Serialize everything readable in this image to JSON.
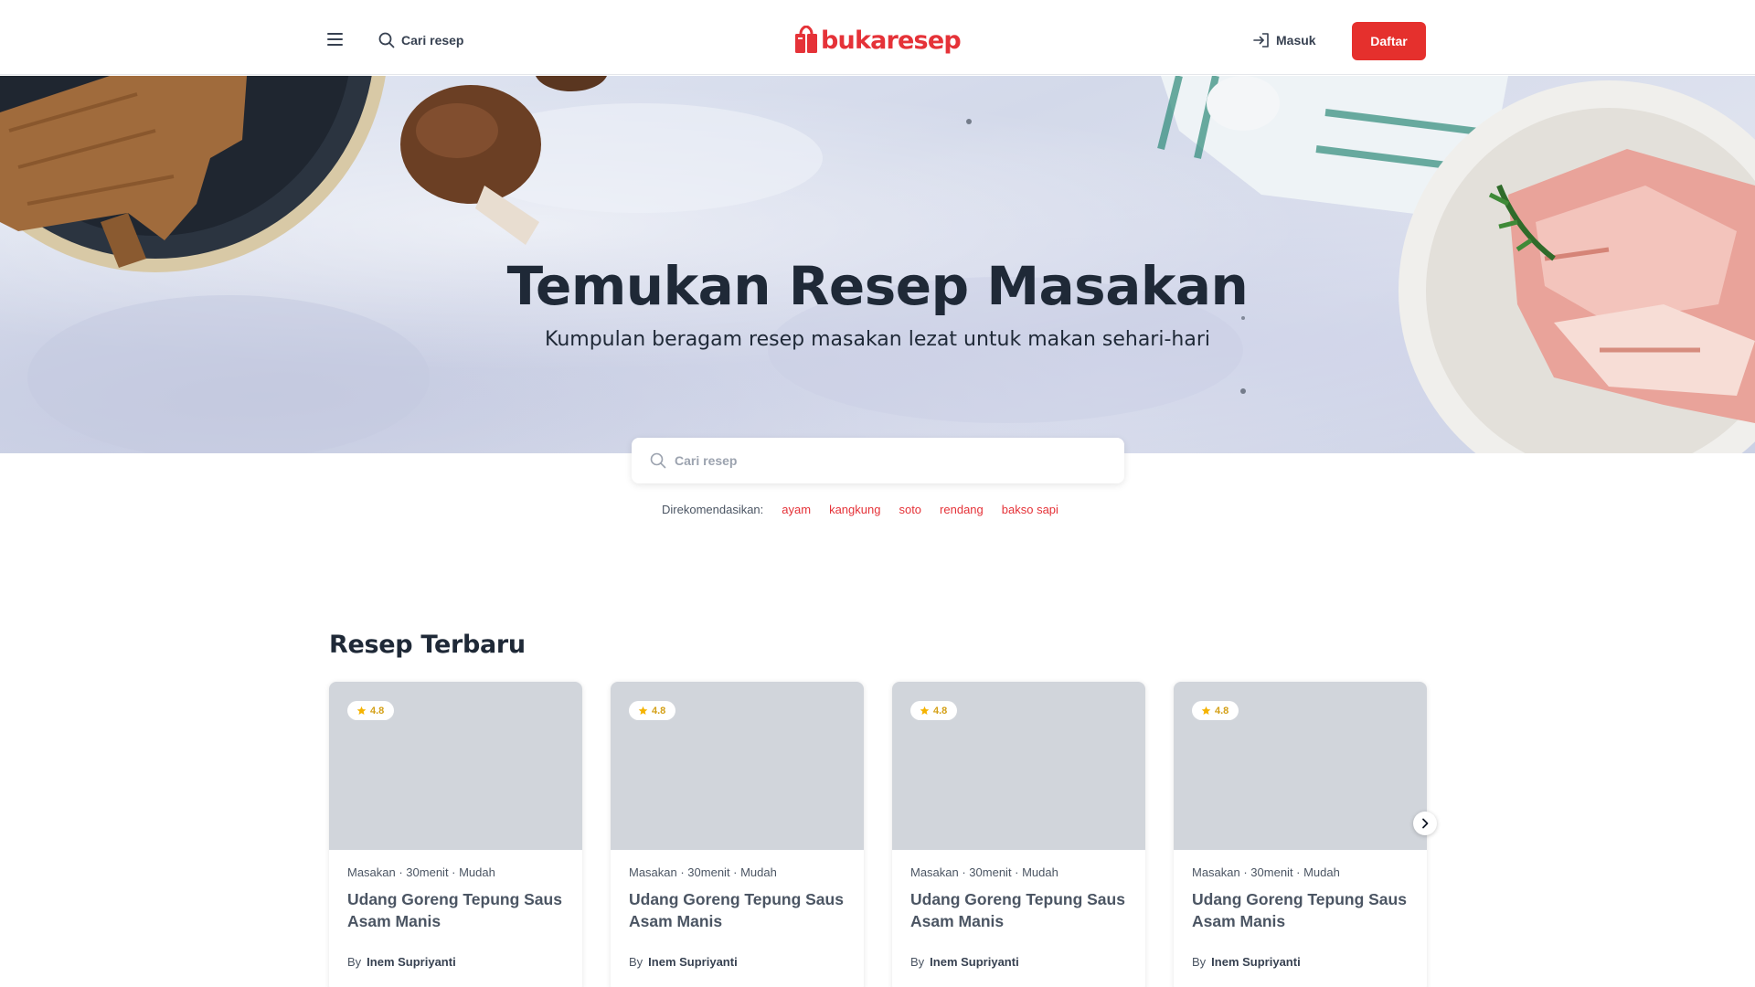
{
  "nav": {
    "search_label": "Cari resep",
    "logo_text": "bukaresep",
    "login_label": "Masuk",
    "register_label": "Daftar"
  },
  "hero": {
    "title": "Temukan Resep Masakan",
    "subtitle": "Kumpulan beragam resep masakan lezat untuk makan sehari-hari"
  },
  "search": {
    "placeholder": "Cari resep",
    "recommend_label": "Direkomendasikan:",
    "tags": [
      "ayam",
      "kangkung",
      "soto",
      "rendang",
      "bakso sapi"
    ]
  },
  "recipes": {
    "section_title": "Resep Terbaru",
    "cards": [
      {
        "rating": "4.8",
        "meta": "Masakan · 30menit · Mudah",
        "title": "Udang Goreng Tepung Saus Asam Manis",
        "by": "By",
        "author": "Inem Supriyanti"
      },
      {
        "rating": "4.8",
        "meta": "Masakan · 30menit · Mudah",
        "title": "Udang Goreng Tepung Saus Asam Manis",
        "by": "By",
        "author": "Inem Supriyanti"
      },
      {
        "rating": "4.8",
        "meta": "Masakan · 30menit · Mudah",
        "title": "Udang Goreng Tepung Saus Asam Manis",
        "by": "By",
        "author": "Inem Supriyanti"
      },
      {
        "rating": "4.8",
        "meta": "Masakan · 30menit · Mudah",
        "title": "Udang Goreng Tepung Saus Asam Manis",
        "by": "By",
        "author": "Inem Supriyanti"
      }
    ]
  },
  "colors": {
    "brand_red": "#e5302d",
    "tag_red": "#e53238",
    "star_yellow": "#f5b301",
    "card_placeholder": "#d1d5db"
  },
  "icons": [
    "hamburger-menu-icon",
    "search-icon",
    "logo-bag-icon",
    "login-icon",
    "star-icon",
    "chevron-right-icon"
  ]
}
